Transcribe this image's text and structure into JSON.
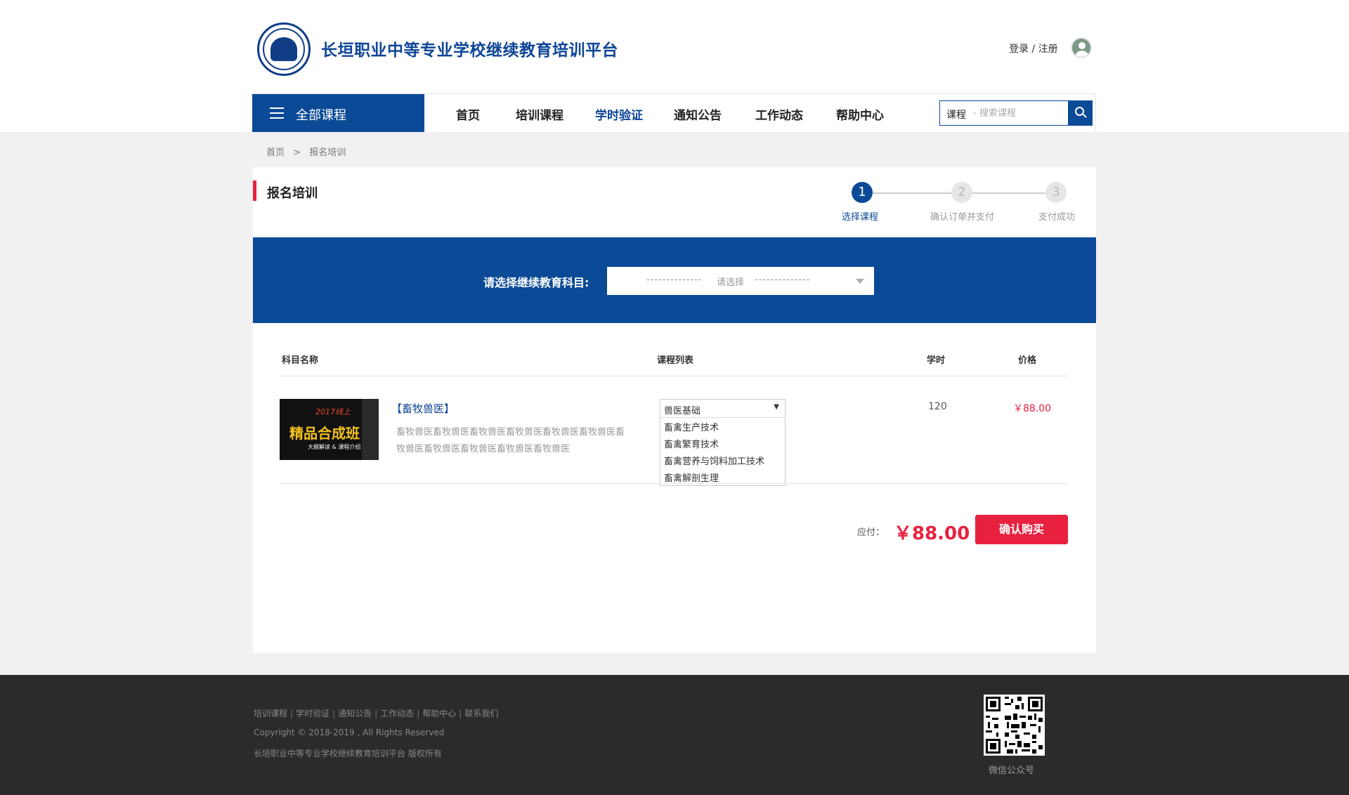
{
  "header": {
    "site_title": "长垣职业中等专业学校继续教育培训平台",
    "login_register": "登录 / 注册",
    "all_courses": "全部课程",
    "nav": [
      {
        "label": "首页"
      },
      {
        "label": "培训课程"
      },
      {
        "label": "学时验证"
      },
      {
        "label": "通知公告"
      },
      {
        "label": "工作动态"
      },
      {
        "label": "帮助中心"
      }
    ],
    "active_nav": "学时验证",
    "search": {
      "category": "课程",
      "placeholder": "搜索课程"
    }
  },
  "breadcrumb": {
    "home": "首页",
    "separator": ">",
    "current": "报名培训"
  },
  "page_title": "报名培训",
  "steps": [
    {
      "number": "1",
      "label": "选择课程",
      "active": true
    },
    {
      "number": "2",
      "label": "确认订单并支付",
      "active": false
    },
    {
      "number": "3",
      "label": "支付成功",
      "active": false
    }
  ],
  "subject": {
    "label": "请选择继续教育科目:",
    "dashes_left": "--------------",
    "placeholder": "请选择",
    "dashes_right": "--------------"
  },
  "table": {
    "headers": {
      "name": "科目名称",
      "course_list": "课程列表",
      "hours": "学时",
      "price": "价格"
    },
    "row": {
      "thumb_year": "2017线上",
      "thumb_main": "精品合成班",
      "thumb_sub": "大纲解读 & 课程介绍",
      "name": "【畜牧兽医】",
      "description": "畜牧兽医畜牧兽医畜牧兽医畜牧兽医畜牧兽医畜牧兽医畜牧兽医畜牧兽医畜牧兽医畜牧兽医畜牧兽医",
      "selected_course": "兽医基础",
      "course_options": [
        "畜禽生产技术",
        "畜禽繁育技术",
        "畜禽营养与饲料加工技术",
        "畜禽解剖生理"
      ],
      "hours": "120",
      "price": "￥88.00"
    }
  },
  "summary": {
    "payable_label": "应付：",
    "amount": "￥88.00",
    "confirm": "确认购买"
  },
  "footer": {
    "links": [
      "培训课程",
      "学时验证",
      "通知公告",
      "工作动态",
      "帮助中心",
      "联系我们"
    ],
    "separator": "|",
    "copyright": "Copyright © 2018-2019 , All Rights Reserved",
    "org": "长垣职业中等专业学校继续教育培训平台  版权所有",
    "qr_caption": "微信公众号"
  },
  "colors": {
    "primary": "#0b4a96",
    "accent": "#e8213f",
    "footer_bg": "#2b2b2b"
  }
}
